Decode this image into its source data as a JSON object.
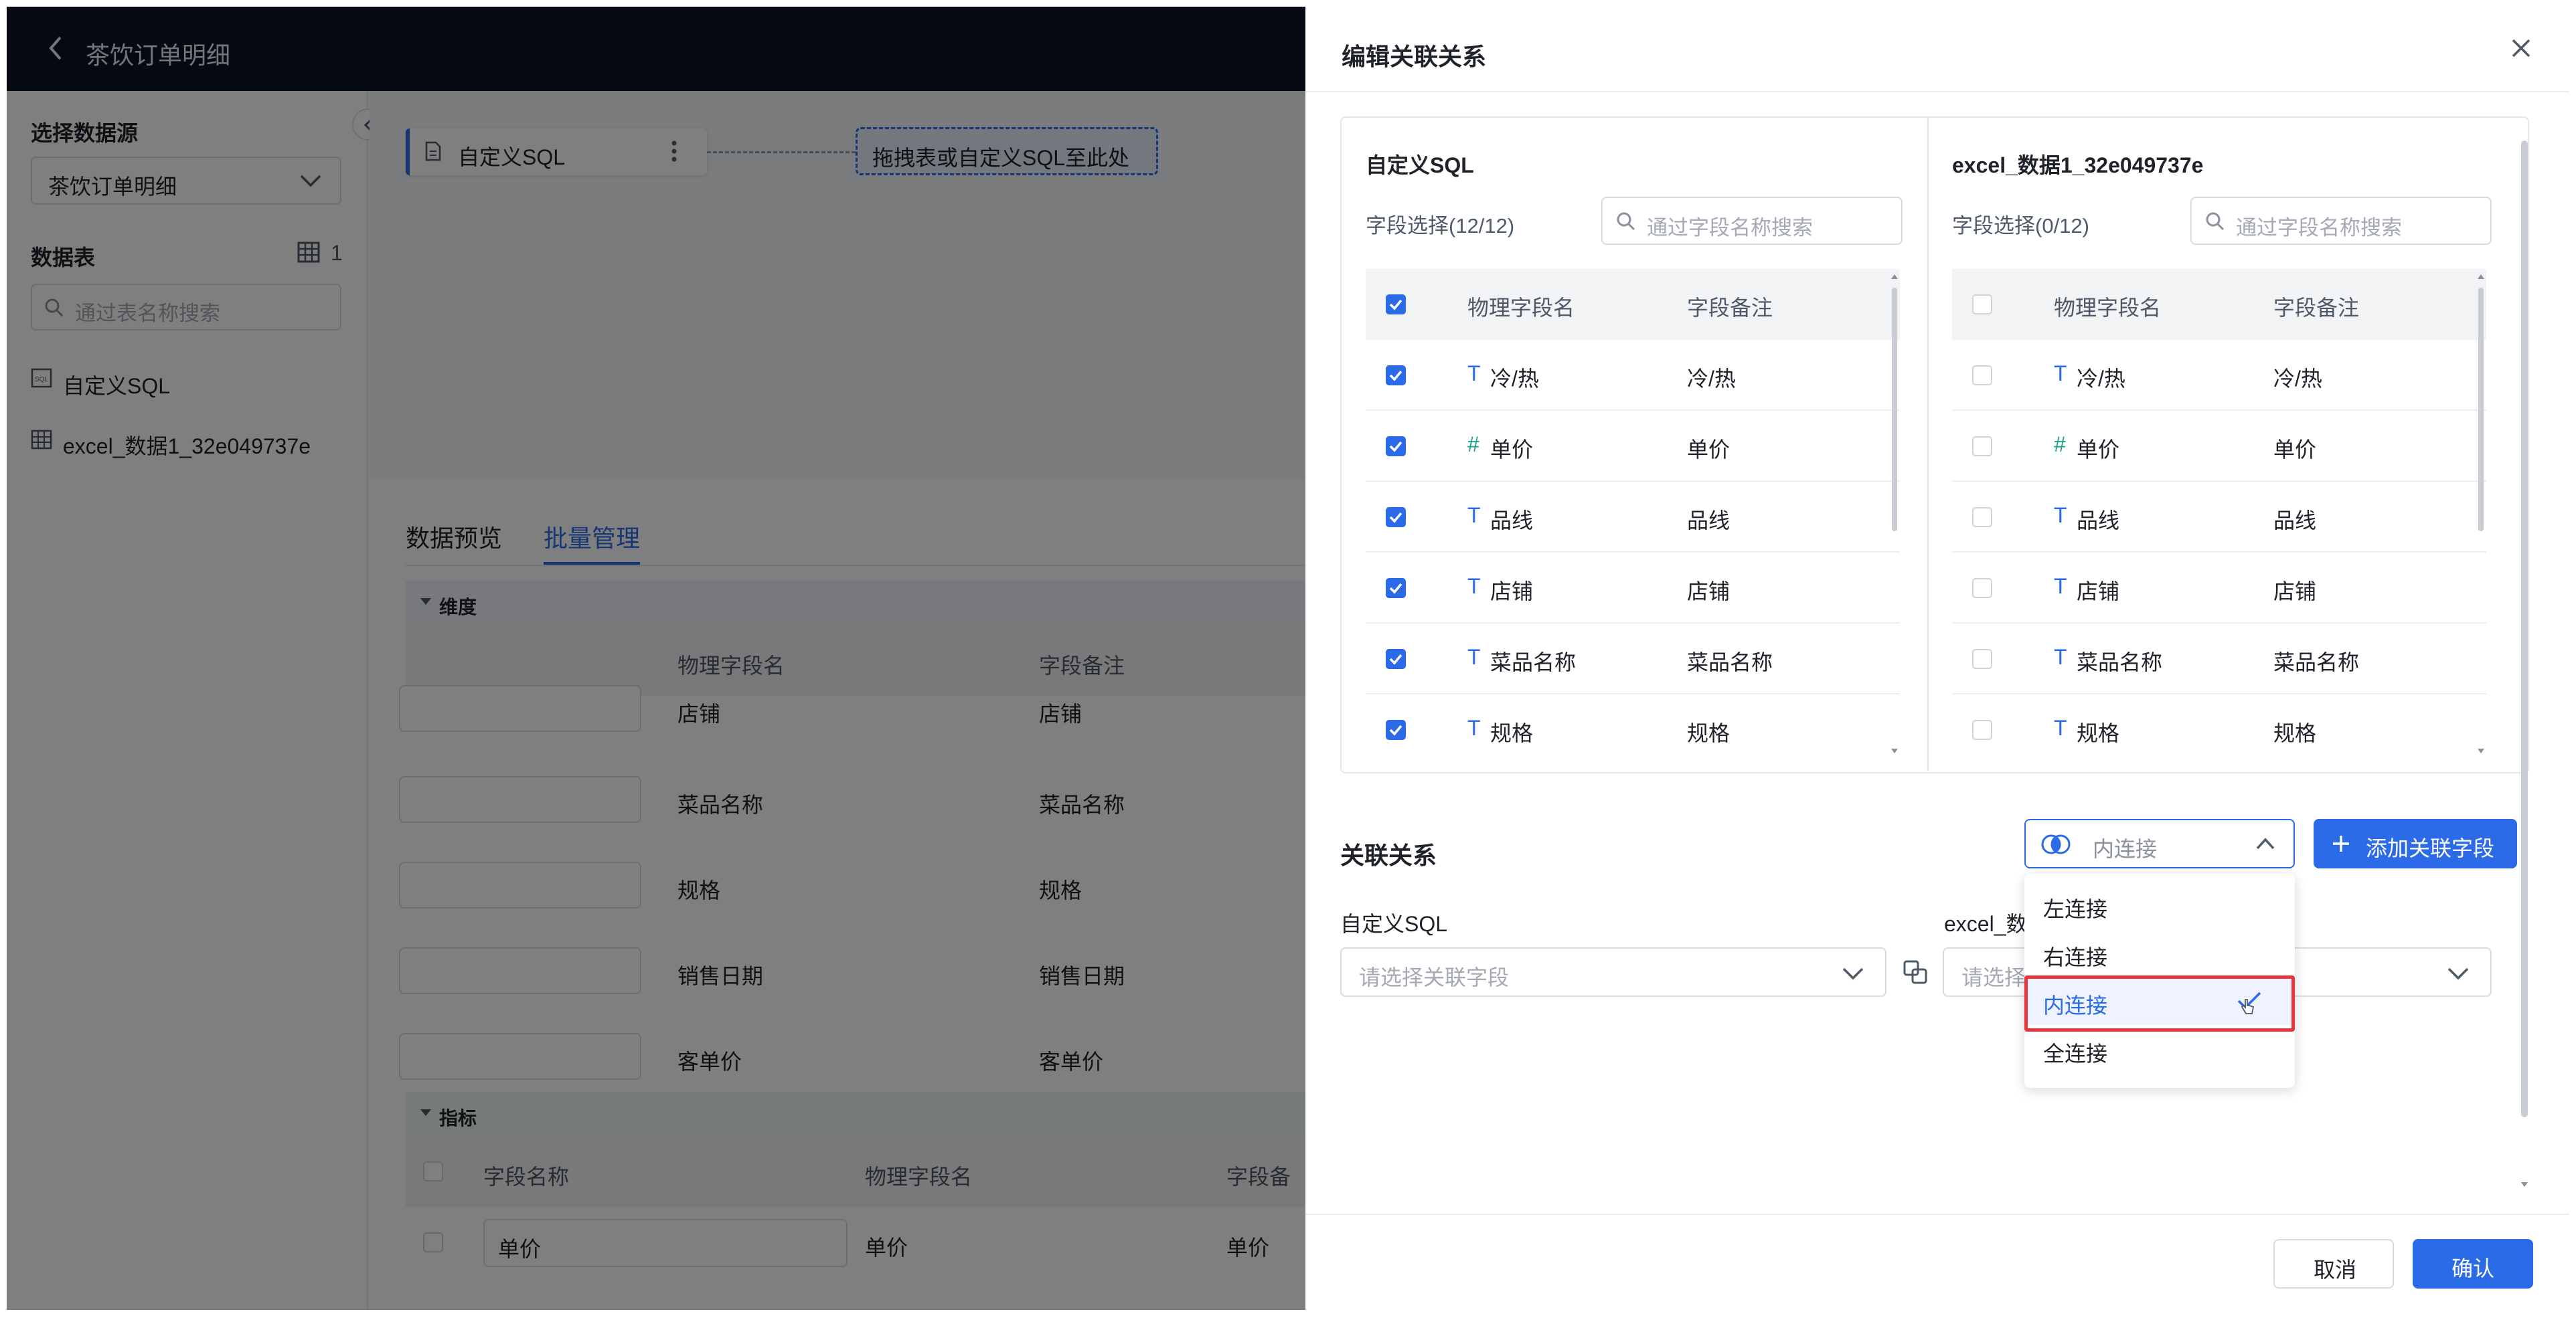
{
  "page": {
    "title": "茶饮订单明细",
    "sidebar": {
      "datasource_label": "选择数据源",
      "datasource_value": "茶饮订单明细",
      "tables_label": "数据表",
      "tables_count": "1",
      "table_search_placeholder": "通过表名称搜索",
      "tables": [
        "自定义SQL",
        "excel_数据1_32e049737e"
      ]
    },
    "canvas": {
      "node_label": "自定义SQL",
      "drop_hint": "拖拽表或自定义SQL至此处"
    },
    "tabs": [
      "数据预览",
      "批量管理"
    ],
    "active_tab": "批量管理",
    "dimension_section": "维度",
    "dimension_headers": [
      "物理字段名",
      "字段备注"
    ],
    "dimension_rows": [
      {
        "name": "店铺",
        "note": "店铺"
      },
      {
        "name": "菜品名称",
        "note": "菜品名称"
      },
      {
        "name": "规格",
        "note": "规格"
      },
      {
        "name": "销售日期",
        "note": "销售日期"
      },
      {
        "name": "客单价",
        "note": "客单价"
      }
    ],
    "metric_section": "指标",
    "metric_headers": [
      "字段名称",
      "物理字段名",
      "字段备"
    ],
    "metric_rows": [
      {
        "field": "单价",
        "name": "单价",
        "note": "单价"
      }
    ]
  },
  "dialog": {
    "title": "编辑关联关系",
    "left_panel": {
      "title": "自定义SQL",
      "selection": "字段选择(12/12)",
      "search_placeholder": "通过字段名称搜索",
      "headers": [
        "物理字段名",
        "字段备注"
      ],
      "all_checked": true,
      "rows": [
        {
          "type": "T",
          "name": "冷/热",
          "note": "冷/热",
          "checked": true
        },
        {
          "type": "#",
          "name": "单价",
          "note": "单价",
          "checked": true
        },
        {
          "type": "T",
          "name": "品线",
          "note": "品线",
          "checked": true
        },
        {
          "type": "T",
          "name": "店铺",
          "note": "店铺",
          "checked": true
        },
        {
          "type": "T",
          "name": "菜品名称",
          "note": "菜品名称",
          "checked": true
        },
        {
          "type": "T",
          "name": "规格",
          "note": "规格",
          "checked": true
        }
      ]
    },
    "right_panel": {
      "title": "excel_数据1_32e049737e",
      "selection": "字段选择(0/12)",
      "search_placeholder": "通过字段名称搜索",
      "headers": [
        "物理字段名",
        "字段备注"
      ],
      "all_checked": false,
      "rows": [
        {
          "type": "T",
          "name": "冷/热",
          "note": "冷/热",
          "checked": false
        },
        {
          "type": "#",
          "name": "单价",
          "note": "单价",
          "checked": false
        },
        {
          "type": "T",
          "name": "品线",
          "note": "品线",
          "checked": false
        },
        {
          "type": "T",
          "name": "店铺",
          "note": "店铺",
          "checked": false
        },
        {
          "type": "T",
          "name": "菜品名称",
          "note": "菜品名称",
          "checked": false
        },
        {
          "type": "T",
          "name": "规格",
          "note": "规格",
          "checked": false
        }
      ]
    },
    "relation": {
      "label": "关联关系",
      "join_value": "内连接",
      "add_button": "添加关联字段",
      "left_label": "自定义SQL",
      "left_placeholder": "请选择关联字段",
      "right_label": "excel_数",
      "right_placeholder": "请选择"
    },
    "join_options": [
      "左连接",
      "右连接",
      "内连接",
      "全连接"
    ],
    "selected_join": "内连接",
    "footer": {
      "cancel": "取消",
      "confirm": "确认"
    },
    "colors": {
      "accent": "#2b6be8",
      "highlight": "#e8363c",
      "number_type": "#14a085"
    }
  }
}
